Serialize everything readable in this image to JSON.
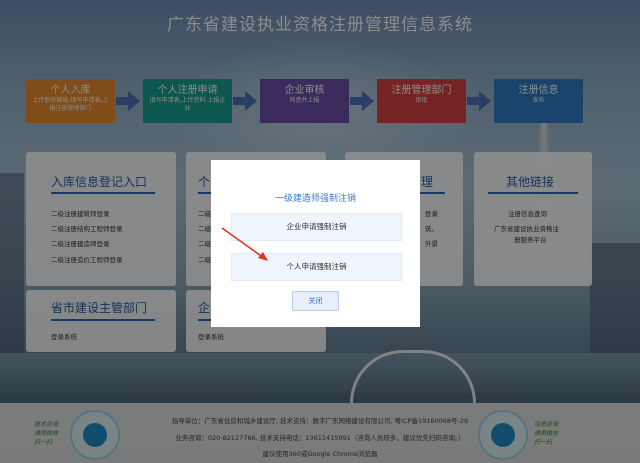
{
  "site": {
    "title": "广东省建设执业资格注册管理信息系统"
  },
  "steps": [
    {
      "label": "个人入库",
      "sub": "上传职称图纸,填写申请表,上报注册管理部门",
      "color": "#e98a2e"
    },
    {
      "label": "个人注册申请",
      "sub": "填写申请表,上传资料 上报企业",
      "color": "#18a08e"
    },
    {
      "label": "企业审核",
      "sub": "同意并上报",
      "color": "#6a4fa8"
    },
    {
      "label": "注册管理部门",
      "sub": "审批",
      "color": "#d84040"
    },
    {
      "label": "注册信息",
      "sub": "发布",
      "color": "#2e7bc4"
    }
  ],
  "cards": {
    "entry": {
      "title": "入库信息登记入口",
      "items": [
        "二级注册建筑师登录",
        "二级注册结构工程师登录",
        "二级注册建造师登录",
        "二级注册造价工程师登录"
      ]
    },
    "middle_partial": {
      "title_partial": "个",
      "items_partial": [
        "二级",
        "二级",
        "二级",
        "二级"
      ]
    },
    "right_partial": {
      "title_partial": "理",
      "items_partial": [
        "登录",
        "筑、",
        "外景"
      ]
    },
    "other": {
      "title": "其他链接",
      "items": [
        "注册信息查询",
        "广东省建设执业资格注",
        "册服务平台"
      ]
    },
    "province": {
      "title": "省市建设主管部门",
      "items": [
        "登录系统"
      ]
    },
    "enterprise_partial": {
      "title_partial": "企",
      "items": [
        "登录系统"
      ]
    }
  },
  "modal": {
    "title": "一级建造师强制注销",
    "options": [
      "企业申请强制注销",
      "个人申请强制注销"
    ],
    "close_label": "关闭"
  },
  "footer": {
    "line1": "指导单位：广东省住房和城乡建设厅, 技术支持：数字广东网络建设有限公司, 粤ICP备19160068号-29",
    "line2": "业务咨询：020-82127766, 技术支持电话：13611415991（咨询人员较多，建议优先扫码咨询。）",
    "line3": "建议使用360或Google Chrome浏览器",
    "slogan_left": [
      "技术咨询",
      "请用微信",
      "扫一扫"
    ],
    "slogan_right": [
      "注册咨询",
      "请用微信",
      "扫一扫"
    ]
  },
  "colors": {
    "accent": "#3a79c7",
    "arrow": "#4d6fb8",
    "annotation": "#e0301e"
  }
}
